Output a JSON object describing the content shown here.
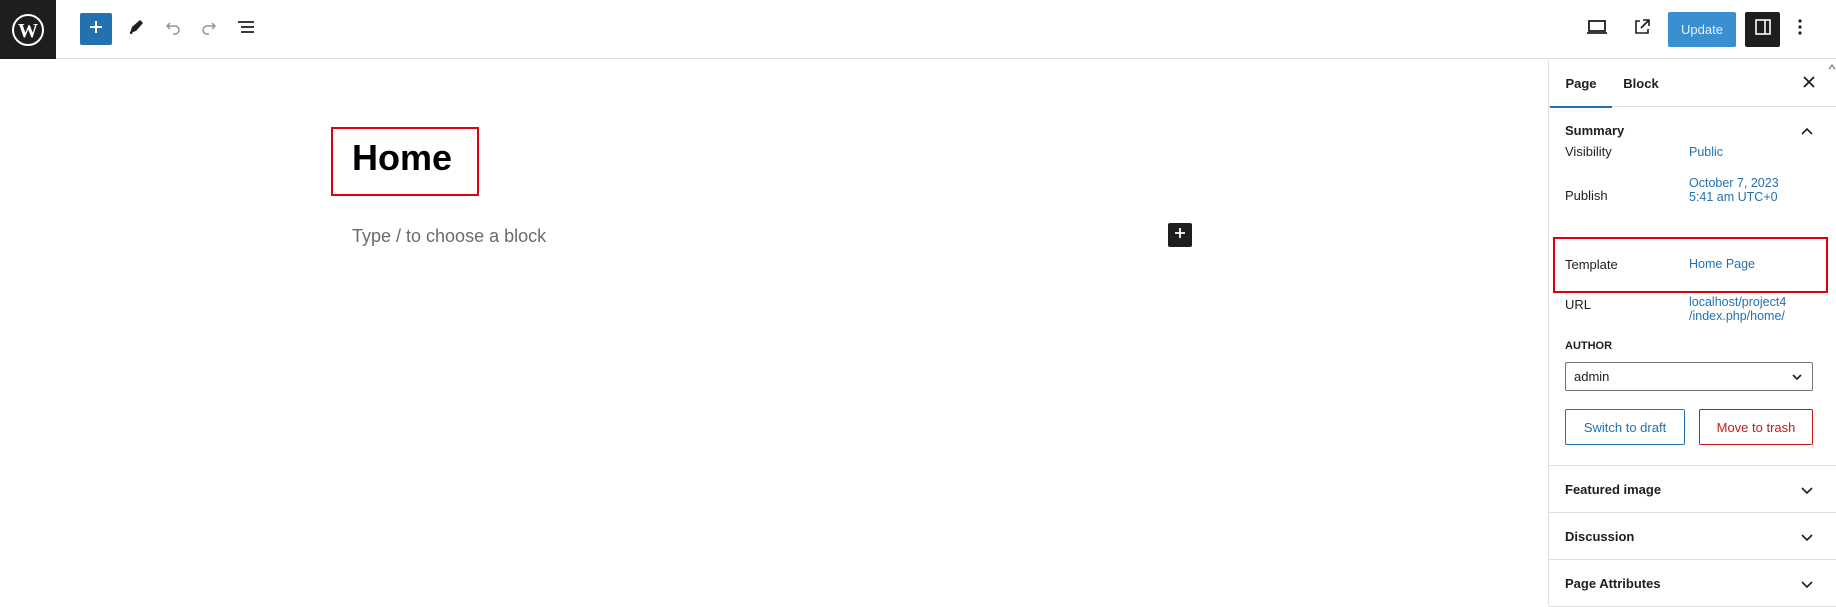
{
  "toolbar": {
    "logo_icon": "wordpress-logo-icon",
    "add_icon": "plus-icon",
    "tools_icon": "pencil-icon",
    "undo_icon": "undo-icon",
    "redo_icon": "redo-icon",
    "outline_icon": "list-view-icon",
    "preview_icon": "desktop-icon",
    "view_icon": "external-link-icon",
    "update_label": "Update",
    "settings_icon": "sidebar-toggle-icon",
    "more_icon": "vertical-ellipsis-icon"
  },
  "editor": {
    "title": "Home",
    "placeholder": "Type / to choose a block",
    "inline_add_icon": "plus-icon"
  },
  "sidebar": {
    "tabs": [
      {
        "label": "Page",
        "active": true
      },
      {
        "label": "Block",
        "active": false
      }
    ],
    "close_icon": "close-icon",
    "summary": {
      "title": "Summary",
      "visibility_label": "Visibility",
      "visibility_value": "Public",
      "publish_label": "Publish",
      "publish_value_line1": "October 7, 2023",
      "publish_value_line2": "5:41 am UTC+0",
      "template_label": "Template",
      "template_value": "Home Page",
      "url_label": "URL",
      "url_value_line1": "localhost/project4",
      "url_value_line2": "/index.php/home/",
      "author_label": "AUTHOR",
      "author_value": "admin",
      "switch_draft_label": "Switch to draft",
      "move_trash_label": "Move to trash"
    },
    "panels": [
      {
        "title": "Featured image"
      },
      {
        "title": "Discussion"
      },
      {
        "title": "Page Attributes"
      }
    ]
  },
  "colors": {
    "accent": "#2271b1",
    "highlight_box": "#e0000f",
    "danger": "#cc1818",
    "dark": "#1e1e1e"
  }
}
